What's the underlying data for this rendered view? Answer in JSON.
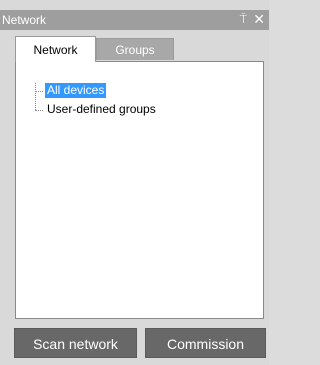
{
  "window": {
    "title": "Network",
    "pin_glyph": "⍑",
    "close_glyph": "✕"
  },
  "tabs": [
    {
      "label": "Network",
      "active": true
    },
    {
      "label": "Groups",
      "active": false
    }
  ],
  "tree": {
    "items": [
      {
        "label": "All devices",
        "selected": true
      },
      {
        "label": "User-defined groups",
        "selected": false
      }
    ]
  },
  "buttons": {
    "scan_label": "Scan network",
    "commission_label": "Commission"
  },
  "colors": {
    "selection": "#3399ff",
    "button_bg": "#686868",
    "titlebar_bg": "#9e9e9e"
  }
}
